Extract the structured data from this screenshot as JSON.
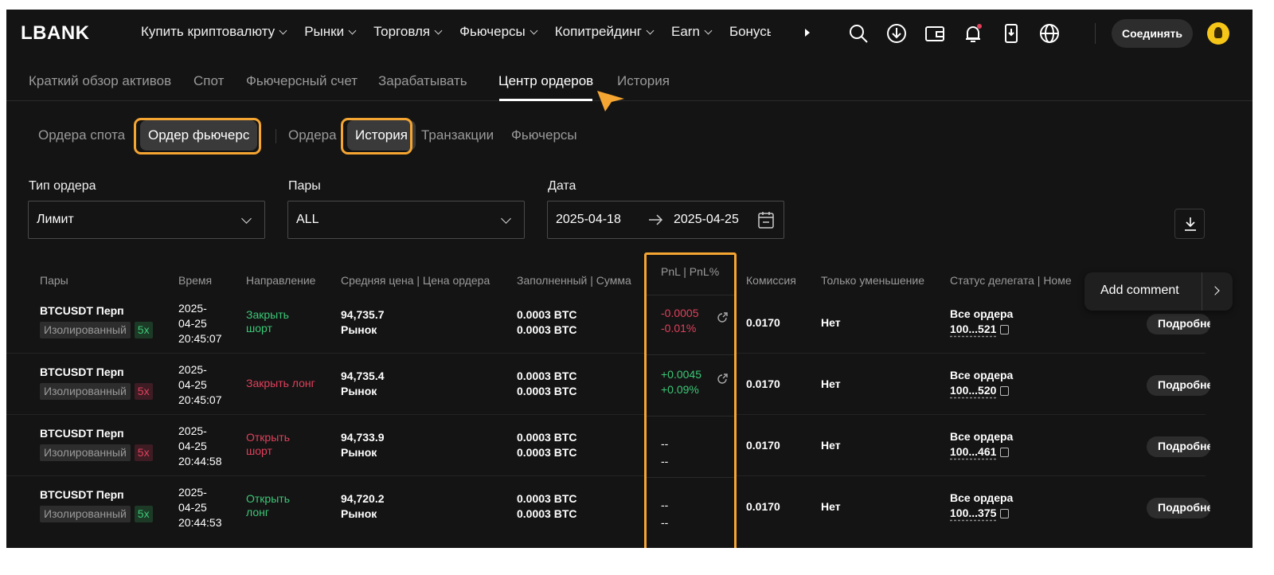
{
  "logo": "LBANK",
  "menu": [
    "Купить криптовалюту",
    "Рынки",
    "Торговля",
    "Фьючерсы",
    "Копитрейдинг",
    "Earn",
    "Бонусы"
  ],
  "nav_icons": [
    "search-icon",
    "download-icon",
    "wallet-icon",
    "bell-icon",
    "mobile-download-icon",
    "globe-icon"
  ],
  "connect_label": "Соединять",
  "account_tabs": [
    "Краткий обзор активов",
    "Спот",
    "Фьючерсный счет",
    "Зарабатывать",
    "Центр ордеров",
    "История"
  ],
  "active_account_tab": "Центр ордеров",
  "sub_tabs": [
    "Ордера спота",
    "Ордер фьючерс",
    "Ордера",
    "История",
    "Транзакции",
    "Фьючерсы"
  ],
  "filters": {
    "order_type_label": "Тип ордера",
    "order_type_value": "Лимит",
    "pairs_label": "Пары",
    "pairs_value": "ALL",
    "date_label": "Дата",
    "date_from": "2025-04-18",
    "date_to": "2025-04-25"
  },
  "table": {
    "headers": [
      "Пары",
      "Время",
      "Направление",
      "Средняя цена | Цена ордера",
      "Заполненный | Сумма",
      "PnL | PnL%",
      "Комиссия",
      "Только уменьшение",
      "Статус делегата | Номе"
    ],
    "rows": [
      {
        "pair": "BTCUSDT Перп",
        "margin": "Изолированный",
        "leverage": "5x",
        "lev_color": "green",
        "date1": "2025-",
        "date2": "04-25",
        "time": "20:45:07",
        "dir1": "Закрыть",
        "dir2": "шорт",
        "dir_color": "green",
        "avg": "94,735.7",
        "ord": "Рынок",
        "filled": "0.0003 BTC",
        "amount": "0.0003 BTC",
        "pnl": "-0.0005",
        "pnl_pct": "-0.01%",
        "pnl_color": "red",
        "fee": "0.0170",
        "reduce": "Нет",
        "deleg_status": "Все ордера",
        "deleg_id": "100...521",
        "action": "Подробнее"
      },
      {
        "pair": "BTCUSDT Перп",
        "margin": "Изолированный",
        "leverage": "5x",
        "lev_color": "red",
        "date1": "2025-",
        "date2": "04-25",
        "time": "20:45:07",
        "dir1": "Закрыть лонг",
        "dir2": "",
        "dir_color": "red",
        "avg": "94,735.4",
        "ord": "Рынок",
        "filled": "0.0003 BTC",
        "amount": "0.0003 BTC",
        "pnl": "+0.0045",
        "pnl_pct": "+0.09%",
        "pnl_color": "green",
        "fee": "0.0170",
        "reduce": "Нет",
        "deleg_status": "Все ордера",
        "deleg_id": "100...520",
        "action": "Подробнее"
      },
      {
        "pair": "BTCUSDT Перп",
        "margin": "Изолированный",
        "leverage": "5x",
        "lev_color": "red",
        "date1": "2025-",
        "date2": "04-25",
        "time": "20:44:58",
        "dir1": "Открыть",
        "dir2": "шорт",
        "dir_color": "red",
        "avg": "94,733.9",
        "ord": "Рынок",
        "filled": "0.0003 BTC",
        "amount": "0.0003 BTC",
        "pnl": "--",
        "pnl_pct": "--",
        "pnl_color": "white",
        "fee": "0.0170",
        "reduce": "Нет",
        "deleg_status": "Все ордера",
        "deleg_id": "100...461",
        "action": "Подробнее"
      },
      {
        "pair": "BTCUSDT Перп",
        "margin": "Изолированный",
        "leverage": "5x",
        "lev_color": "green",
        "date1": "2025-",
        "date2": "04-25",
        "time": "20:44:53",
        "dir1": "Открыть",
        "dir2": "лонг",
        "dir_color": "green",
        "avg": "94,720.2",
        "ord": "Рынок",
        "filled": "0.0003 BTC",
        "amount": "0.0003 BTC",
        "pnl": "--",
        "pnl_pct": "--",
        "pnl_color": "white",
        "fee": "0.0170",
        "reduce": "Нет",
        "deleg_status": "Все ордера",
        "deleg_id": "100...375",
        "action": "Подробнее"
      }
    ]
  },
  "comment_popup": "Add comment",
  "colors": {
    "accent_highlight": "#f5a532",
    "green": "#3cc776",
    "red": "#e0405b",
    "background": "#141414"
  }
}
